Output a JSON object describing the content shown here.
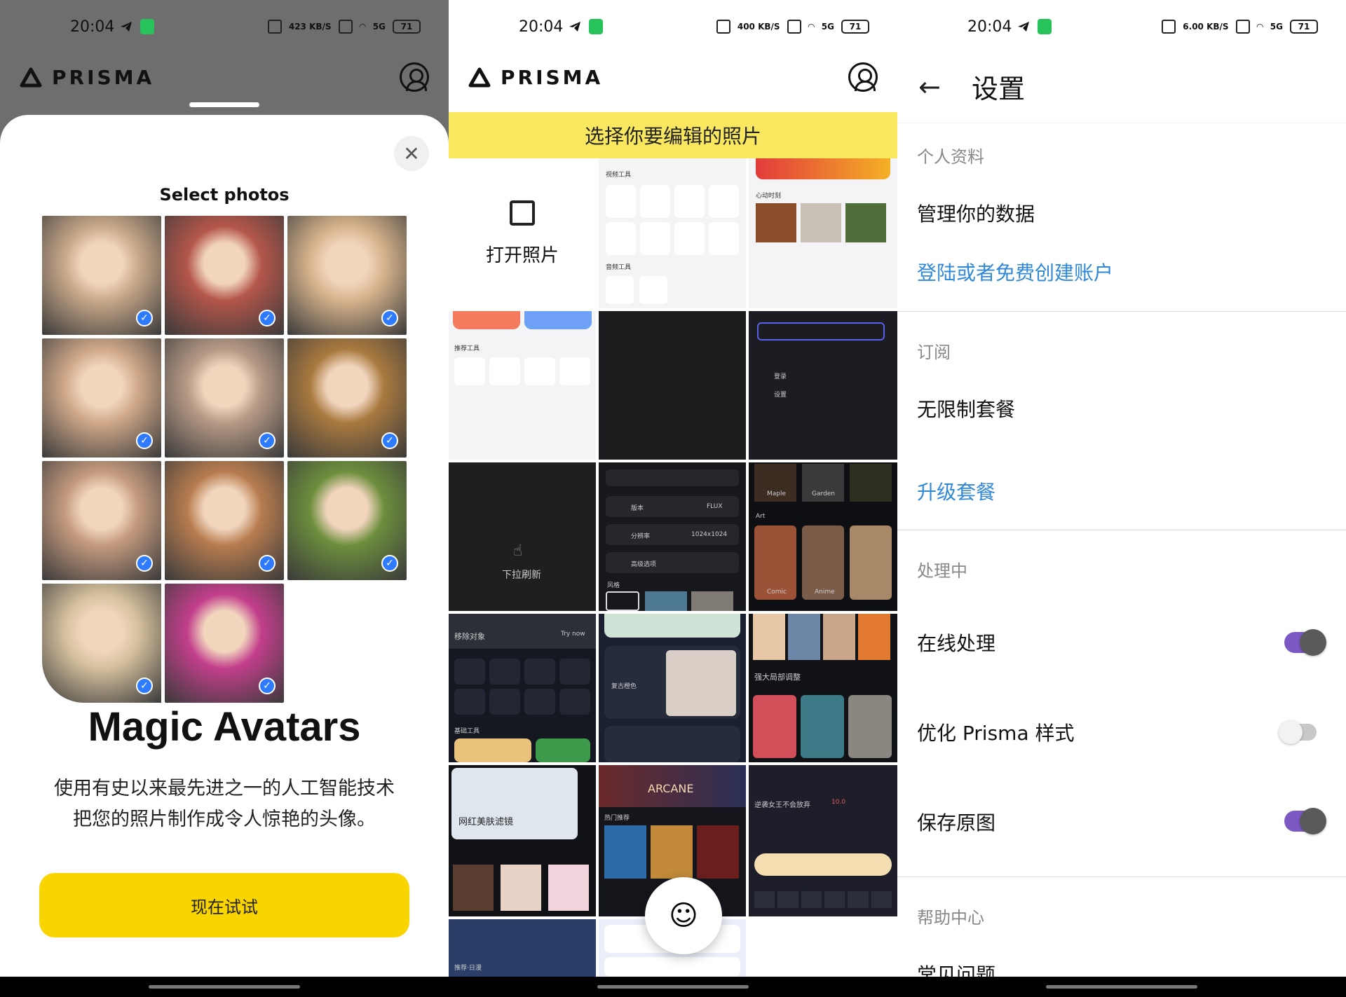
{
  "status": {
    "time": "20:04",
    "speed1": "423 KB/S",
    "speed2": "400 KB/S",
    "speed3": "6.00 KB/S",
    "battery": "71",
    "net": "5G"
  },
  "brand": {
    "name": "PRISMA"
  },
  "panel1": {
    "sheet_title": "Select photos",
    "headline": "Magic Avatars",
    "description_line1": "使用有史以来最先进之一的人工智能技术",
    "description_line2": "把您的照片制作成令人惊艳的头像。",
    "cta_label": "现在试试",
    "close_glyph": "✕",
    "photos": [
      {
        "tone": "#c9a98a",
        "checked": true
      },
      {
        "tone": "#b4564a",
        "checked": true
      },
      {
        "tone": "#d8b48c",
        "checked": true
      },
      {
        "tone": "#cfa889",
        "checked": true
      },
      {
        "tone": "#b79a86",
        "checked": true
      },
      {
        "tone": "#a9793f",
        "checked": true
      },
      {
        "tone": "#c49a7e",
        "checked": true
      },
      {
        "tone": "#b77c4f",
        "checked": true
      },
      {
        "tone": "#6d8e3d",
        "checked": true
      },
      {
        "tone": "#d5c09d",
        "checked": true
      },
      {
        "tone": "#c23f8b",
        "checked": true
      }
    ]
  },
  "panel2": {
    "banner": "选择你要编辑的照片",
    "open_photo": "打开照片",
    "pull_refresh": "下拉刷新",
    "tiles": {
      "video_tools": "视频工具",
      "audio_tools": "音频工具",
      "moments": "心动时刻",
      "recommend": "推荐工具",
      "remove_object": "移除对象",
      "try_now": "Try now",
      "basic_tools": "基础工具",
      "version": "版本",
      "flux": "FLUX",
      "resolution": "分辨率",
      "res_value": "1024x1024",
      "advanced": "高级选项",
      "style": "风格",
      "art": "Art",
      "maple": "Maple",
      "garden": "Garden",
      "comic": "Comic",
      "anime": "Anime",
      "local_adjust": "强大局部调整",
      "retro": "复古橙色",
      "beauty_filter": "网红美肤滤镜",
      "arcane": "ARCANE",
      "hot": "热门推荐",
      "queen": "逆袭女王不会放弃",
      "rating": "10.0",
      "recommend_daily": "推荐·日漫",
      "login": "登录",
      "settings": "设置"
    },
    "fab_glyph": "☺"
  },
  "panel3": {
    "back_glyph": "←",
    "title": "设置",
    "sections": {
      "profile": {
        "header": "个人资料",
        "manage": "管理你的数据",
        "login": "登陆或者免费创建账户"
      },
      "subscription": {
        "header": "订阅",
        "plan": "无限制套餐",
        "upgrade": "升级套餐"
      },
      "processing": {
        "header": "处理中",
        "online": "在线处理",
        "online_on": true,
        "optimize": "优化 Prisma 样式",
        "optimize_on": false,
        "save_original": "保存原图",
        "save_original_on": true
      },
      "help": {
        "header": "帮助中心",
        "faq": "常见问题"
      }
    }
  }
}
